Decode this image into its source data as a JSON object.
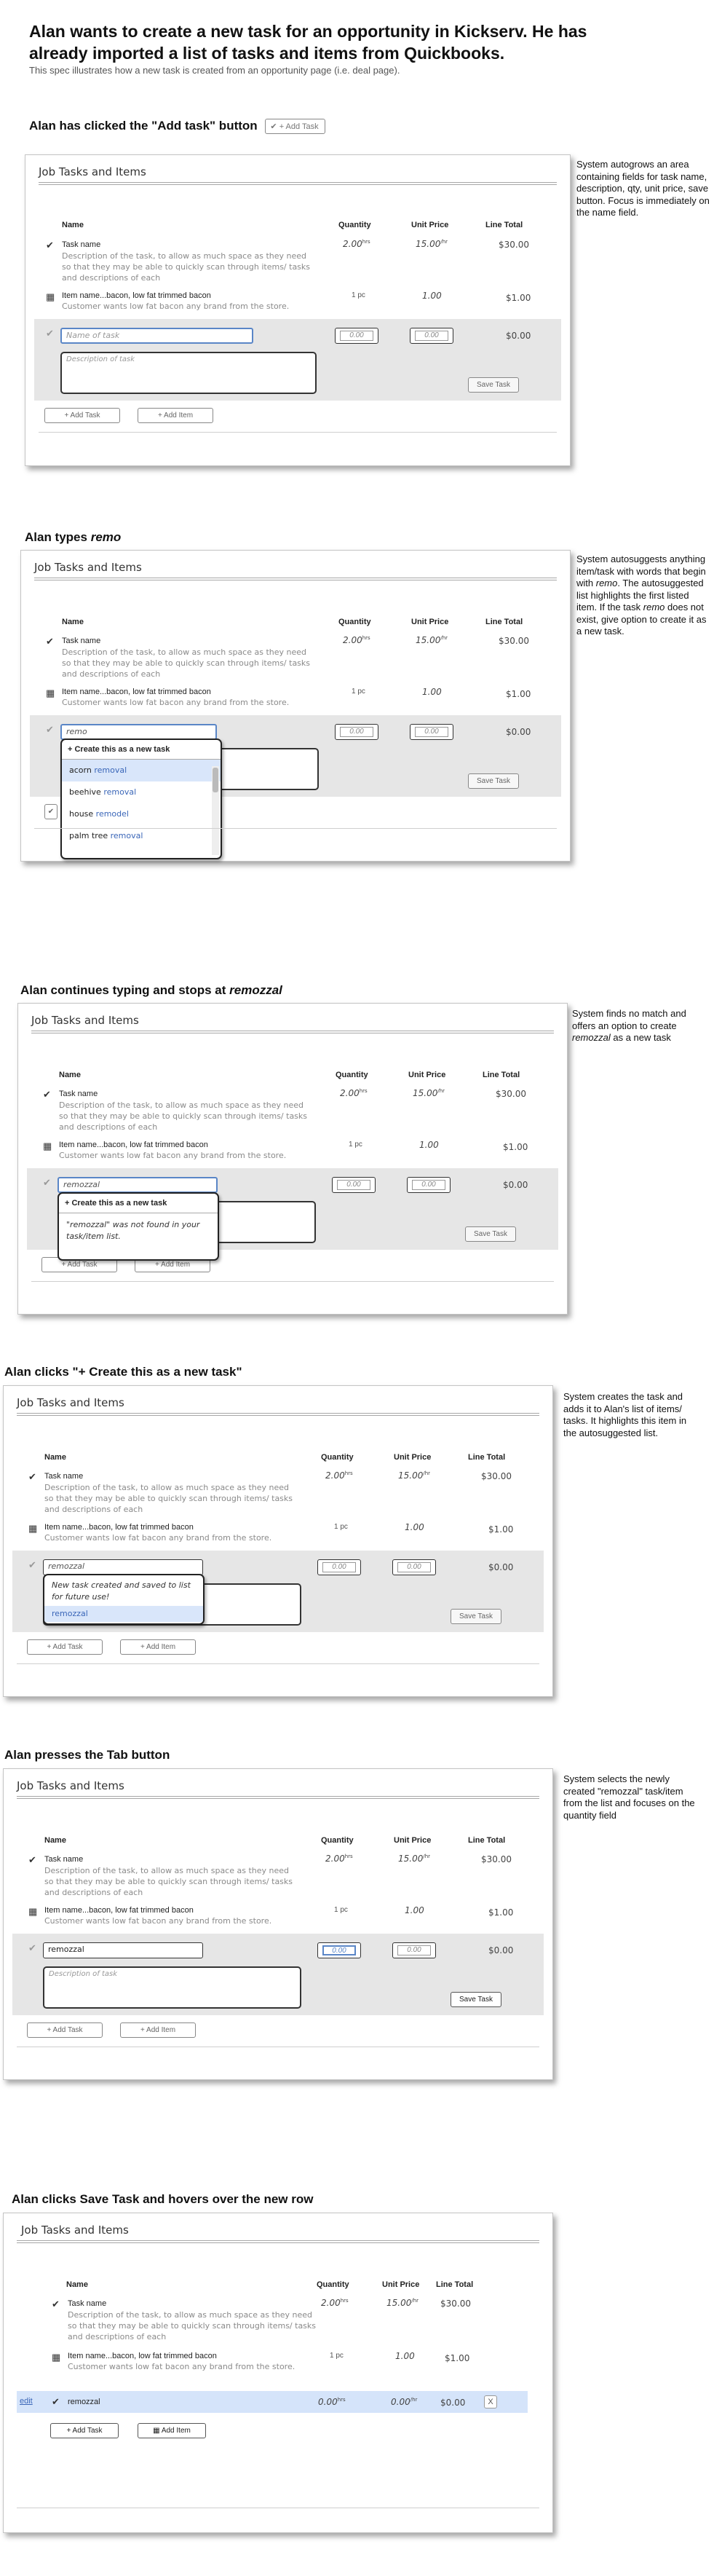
{
  "header": {
    "title": "Alan wants to create a new task for an opportunity in Kickserv. He has already imported a list of tasks and items from Quickbooks.",
    "subtitle": "This spec illustrates how a new task is created from an opportunity page (i.e. deal page)."
  },
  "common": {
    "panel_title": "Job Tasks and Items",
    "columns": {
      "name": "Name",
      "qty": "Quantity",
      "price": "Unit Price",
      "total": "Line Total"
    },
    "task_row": {
      "name": "Task name",
      "desc": "Description of the task, to allow as much space as they need so that they may be able to quickly scan through items/ tasks and descriptions of each",
      "qty": "2.00",
      "qty_unit": "hrs",
      "price": "15.00",
      "price_unit": "/hr",
      "total": "$30.00"
    },
    "item_row": {
      "name": "Item name...bacon, low fat trimmed bacon",
      "desc": "Customer wants low fat bacon any brand from the store.",
      "qty": "1 pc",
      "price": "1.00",
      "total": "$1.00"
    },
    "name_placeholder": "Name of task",
    "desc_placeholder": "Description of task",
    "qty_placeholder": "0.00",
    "price_placeholder": "0.00",
    "new_total": "$0.00",
    "save_label": "Save Task",
    "add_task_label": "+ Add Task",
    "add_item_label": "+ Add Item",
    "create_option": "+ Create this as a new task"
  },
  "step1": {
    "heading": "Alan has clicked the \"Add task\" button",
    "heading_button": "+ Add Task",
    "notes": "System autogrows an area containing fields for task name, description, qty, unit price, save button. Focus is immediately on the name field."
  },
  "step2": {
    "heading_prefix": "Alan types ",
    "heading_em": "remo",
    "notes_1": "System autosuggests anything item/task with words that begin with ",
    "notes_em1": "remo",
    "notes_2": ". The autosuggested list highlights the first listed item. If the task ",
    "notes_em2": "remo",
    "notes_3": " does not exist, give option to create it as a new task.",
    "typed": "remo",
    "suggestions": [
      {
        "pre": "acorn ",
        "hit": "remo",
        "post": "val"
      },
      {
        "pre": "beehive ",
        "hit": "remo",
        "post": "val"
      },
      {
        "pre": "house ",
        "hit": "remo",
        "post": "del"
      },
      {
        "pre": "palm tree ",
        "hit": "remo",
        "post": "val"
      }
    ]
  },
  "step3": {
    "heading_prefix": "Alan continues typing and stops at ",
    "heading_em": "remozzal",
    "notes_1": "System finds no match and offers an option to create ",
    "notes_em": "remozzal",
    "notes_2": " as a new task",
    "typed": "remozzal",
    "not_found": "\"remozzal\" was not found in your task/item list."
  },
  "step4": {
    "heading": "Alan clicks \"+  Create this as a new task\"",
    "notes": "System creates the task and adds it to Alan's list of items/ tasks. It highlights this item in the autosuggested list.",
    "typed": "remozzal",
    "created_msg": "New task created and saved to list for future use!",
    "created_item": "remozzal"
  },
  "step5": {
    "heading": "Alan presses the Tab button",
    "notes": "System selects the newly created \"remozzal\" task/item from the list and focuses on the quantity field",
    "typed": "remozzal"
  },
  "step6": {
    "heading": "Alan clicks Save Task and hovers over the new row",
    "edit_label": "edit",
    "new_name": "remozzal",
    "new_qty": "0.00",
    "new_qty_unit": "hrs",
    "new_price": "0.00",
    "new_price_unit": "/hr",
    "new_total": "$0.00",
    "delete_label": "X",
    "add_task_label": "+ Add Task",
    "add_item_label": "Add Item"
  }
}
